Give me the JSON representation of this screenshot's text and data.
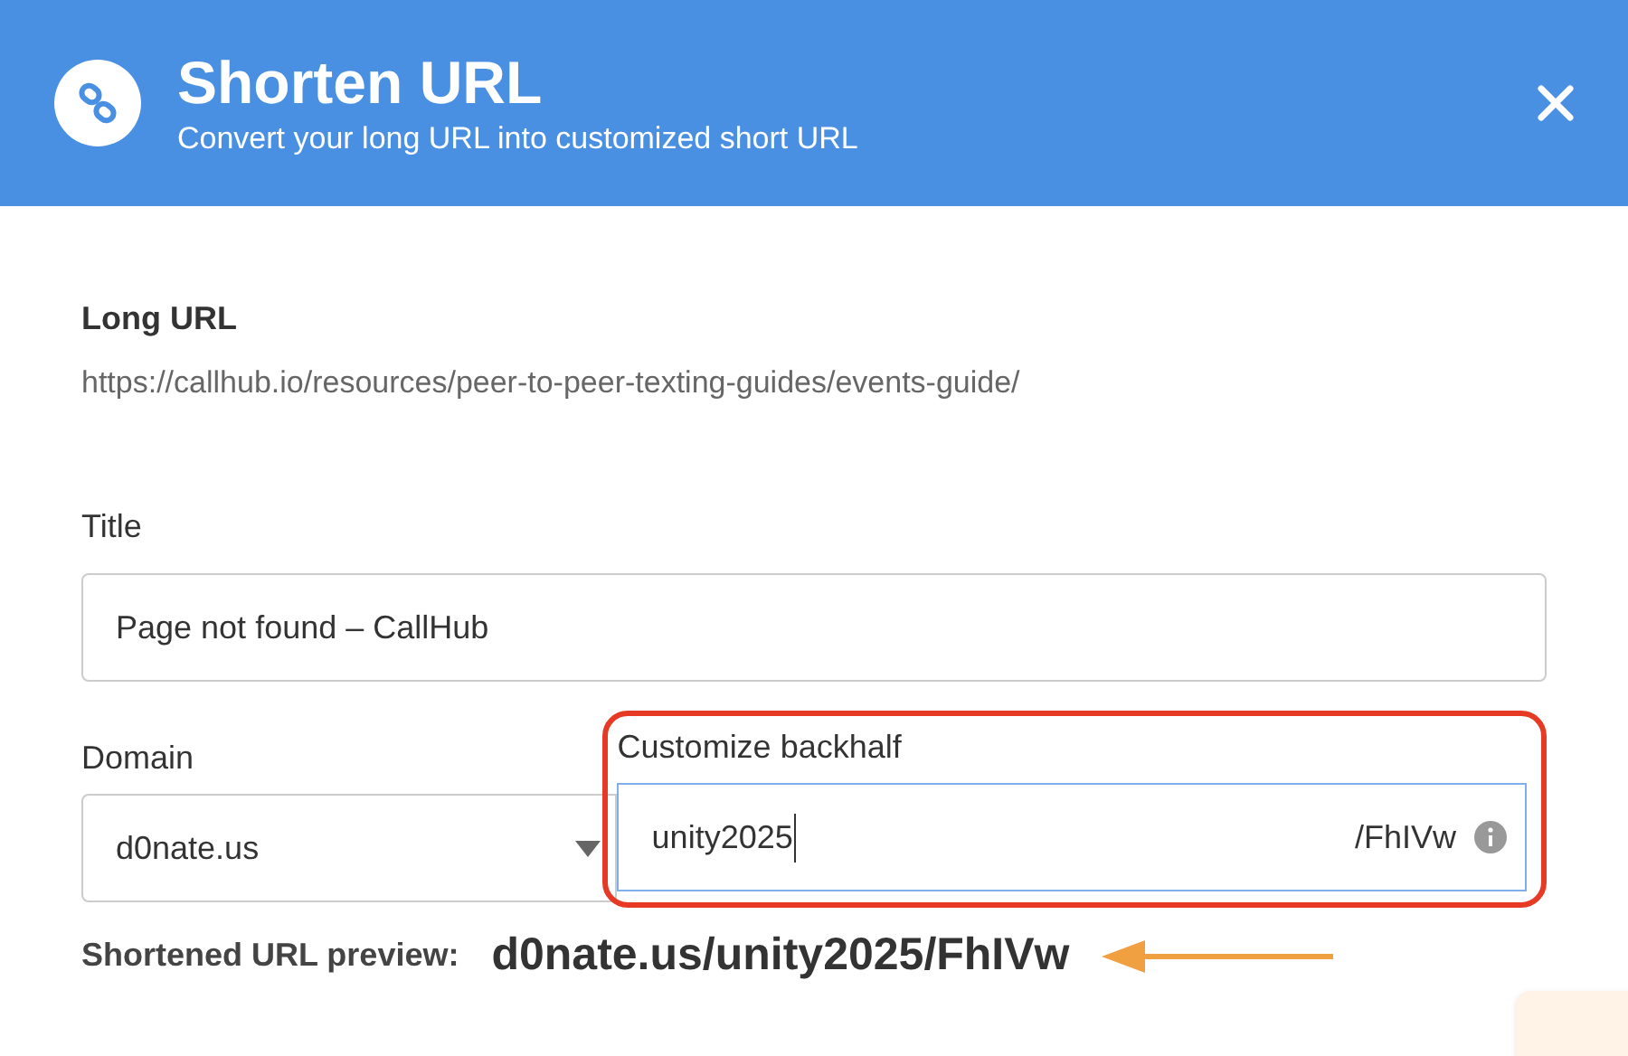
{
  "header": {
    "title": "Shorten URL",
    "subtitle": "Convert your long URL into customized short URL"
  },
  "long_url": {
    "label": "Long URL",
    "value": "https://callhub.io/resources/peer-to-peer-texting-guides/events-guide/"
  },
  "title_field": {
    "label": "Title",
    "value": "Page not found – CallHub"
  },
  "domain": {
    "label": "Domain",
    "value": "d0nate.us"
  },
  "backhalf": {
    "label": "Customize backhalf",
    "value": "unity2025",
    "suffix": "/FhIVw",
    "highlighted": true
  },
  "preview": {
    "label": "Shortened URL preview:",
    "value": "d0nate.us/unity2025/FhIVw"
  }
}
